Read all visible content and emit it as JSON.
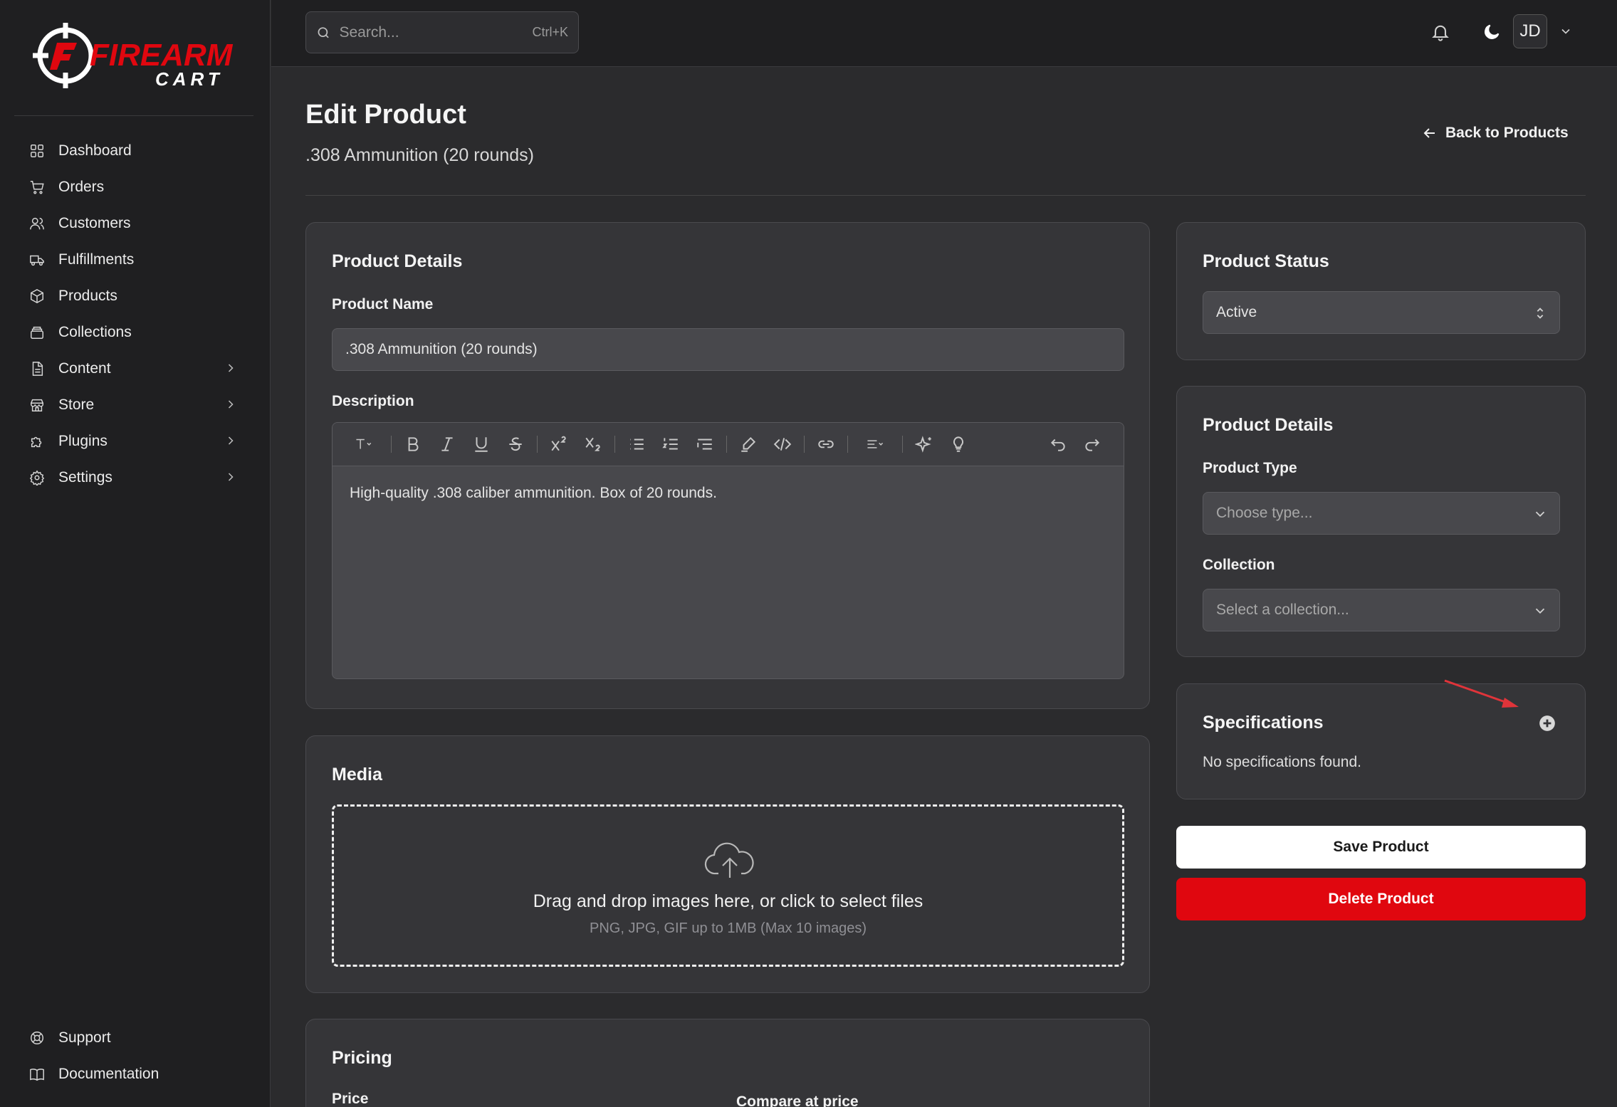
{
  "brand": {
    "logo_line1": "FIREARM",
    "logo_line2": "CART",
    "accent": "#e0070f"
  },
  "sidebar": {
    "items": [
      {
        "label": "Dashboard",
        "icon": "grid-icon"
      },
      {
        "label": "Orders",
        "icon": "cart-icon"
      },
      {
        "label": "Customers",
        "icon": "users-icon"
      },
      {
        "label": "Fulfillments",
        "icon": "truck-icon"
      },
      {
        "label": "Products",
        "icon": "box-icon"
      },
      {
        "label": "Collections",
        "icon": "layers-icon"
      },
      {
        "label": "Content",
        "icon": "file-icon",
        "expandable": true
      },
      {
        "label": "Store",
        "icon": "store-icon",
        "expandable": true
      },
      {
        "label": "Plugins",
        "icon": "puzzle-icon",
        "expandable": true
      },
      {
        "label": "Settings",
        "icon": "gear-icon",
        "expandable": true
      }
    ],
    "bottom": [
      {
        "label": "Support",
        "icon": "lifebuoy-icon"
      },
      {
        "label": "Documentation",
        "icon": "book-icon"
      }
    ]
  },
  "header": {
    "search_placeholder": "Search...",
    "search_shortcut": "Ctrl+K",
    "avatar_initials": "JD"
  },
  "page": {
    "title": "Edit Product",
    "subtitle": ".308 Ammunition (20 rounds)",
    "back_label": "Back to Products"
  },
  "product_details": {
    "title": "Product Details",
    "name_label": "Product Name",
    "name_value": ".308 Ammunition (20 rounds)",
    "description_label": "Description",
    "description_value": "High-quality .308 caliber ammunition. Box of 20 rounds."
  },
  "media": {
    "title": "Media",
    "drop_text": "Drag and drop images here, or click to select files",
    "drop_hint": "PNG, JPG, GIF up to 1MB (Max 10 images)"
  },
  "pricing": {
    "title": "Pricing",
    "price_label": "Price",
    "compare_label": "Compare at price"
  },
  "status": {
    "title": "Product Status",
    "value": "Active"
  },
  "side_details": {
    "title": "Product Details",
    "type_label": "Product Type",
    "type_placeholder": "Choose type...",
    "collection_label": "Collection",
    "collection_placeholder": "Select a collection..."
  },
  "specifications": {
    "title": "Specifications",
    "empty": "No specifications found."
  },
  "actions": {
    "save": "Save Product",
    "delete": "Delete Product"
  }
}
